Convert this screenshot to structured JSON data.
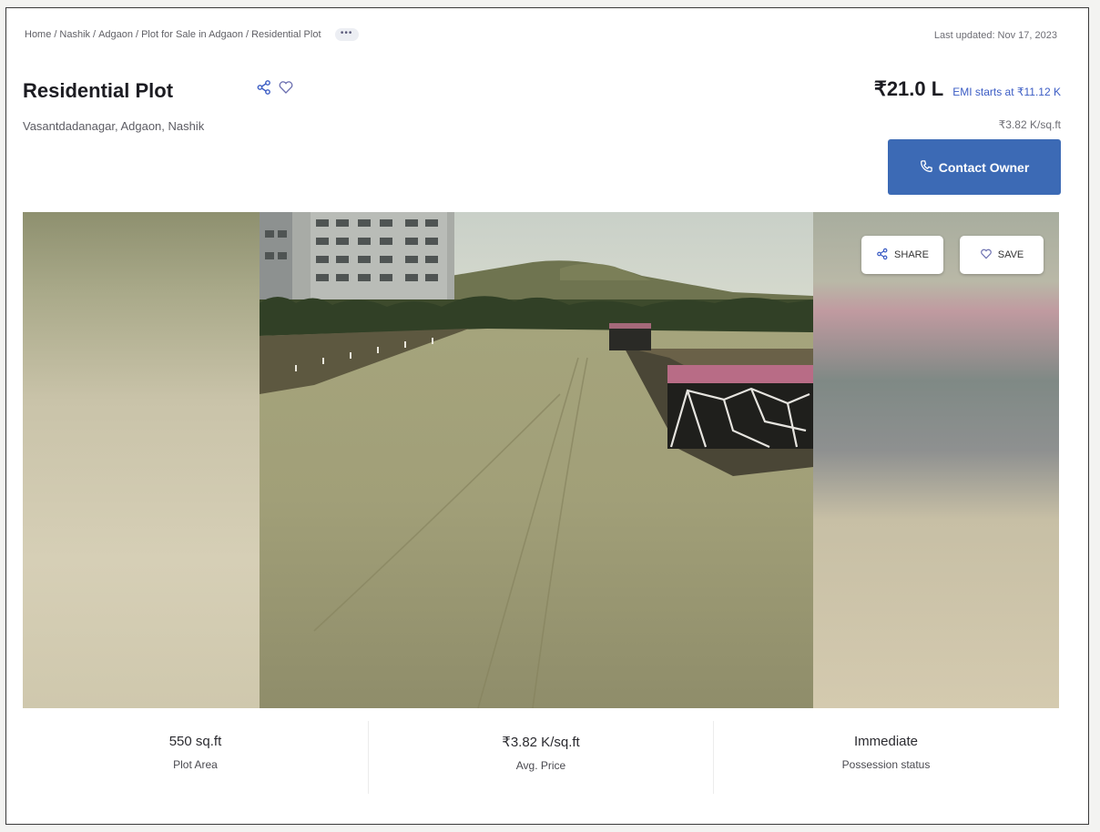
{
  "breadcrumb": {
    "items": [
      "Home",
      "Nashik",
      "Adgaon",
      "Plot for Sale in Adgaon",
      "Residential Plot"
    ],
    "more_label": "•••"
  },
  "last_updated": "Last updated: Nov 17, 2023",
  "listing": {
    "title": "Residential Plot",
    "location": "Vasantdadanagar, Adgaon, Nashik"
  },
  "pricing": {
    "price": "₹21.0 L",
    "emi": "EMI starts at ₹11.12 K",
    "rate": "₹3.82 K/sq.ft"
  },
  "actions": {
    "contact_label": "Contact Owner",
    "share_label": "SHARE",
    "save_label": "SAVE"
  },
  "stats": [
    {
      "value": "550 sq.ft",
      "label": "Plot Area"
    },
    {
      "value": "₹3.82 K/sq.ft",
      "label": "Avg. Price"
    },
    {
      "value": "Immediate",
      "label": "Possession status"
    }
  ],
  "icons": {
    "share": "share-icon",
    "heart": "heart-icon",
    "phone": "phone-icon"
  },
  "colors": {
    "accent": "#3c6ab5",
    "link": "#3b5cc4"
  }
}
